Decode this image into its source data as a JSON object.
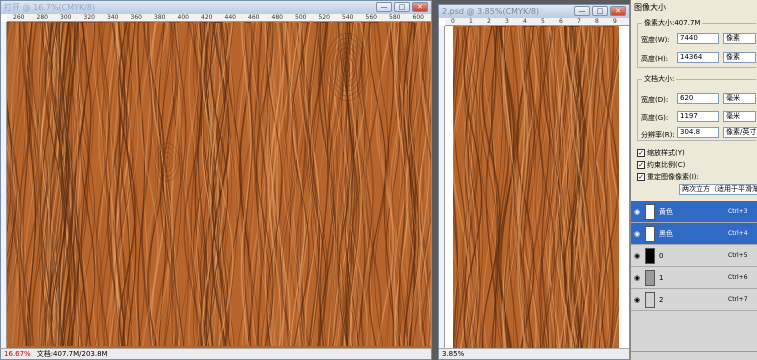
{
  "window1": {
    "title": "打开 @ 16.7%(CMYK/8)",
    "ruler_ticks": [
      "260",
      "280",
      "300",
      "320",
      "340",
      "360",
      "380",
      "400",
      "420",
      "440",
      "460",
      "480",
      "500",
      "520",
      "540",
      "560",
      "580",
      "600"
    ],
    "status_zoom": "16.67%",
    "status_doc": "文档:407.7M/203.8M"
  },
  "window2": {
    "title": "2.psd @ 3.85%(CMYK/8)",
    "ruler_ticks": [
      "0",
      "1",
      "2",
      "3",
      "4",
      "5",
      "6",
      "7",
      "8",
      "9"
    ],
    "status_zoom": "3.85%"
  },
  "window_buttons": {
    "min": "—",
    "max": "□",
    "close": "✕"
  },
  "panel": {
    "title": "图像大小",
    "pixel_group": {
      "legend": "像素大小:407.7M",
      "width_label": "宽度(W):",
      "width_value": "7440",
      "width_unit": "像素",
      "height_label": "高度(H):",
      "height_value": "14364",
      "height_unit": "像素"
    },
    "doc_group": {
      "legend": "文档大小:",
      "width_label": "宽度(D):",
      "width_value": "620",
      "width_unit": "毫米",
      "height_label": "高度(G):",
      "height_value": "1197",
      "height_unit": "毫米",
      "res_label": "分辨率(R):",
      "res_value": "304.8",
      "res_unit": "像素/英寸"
    },
    "checkboxes": [
      {
        "label": "缩放样式(Y)",
        "checked": "✓"
      },
      {
        "label": "约束比例(C)",
        "checked": "✓"
      },
      {
        "label": "重定图像像素(I):",
        "checked": "✓"
      }
    ],
    "resample": "两次立方（适用于平滑渐变）"
  },
  "layers": [
    {
      "name": "黄色",
      "shortcut": "Ctrl+3",
      "thumb": "#ffffff",
      "selected": true
    },
    {
      "name": "黑色",
      "shortcut": "Ctrl+4",
      "thumb": "#ffffff",
      "selected": true
    },
    {
      "name": "0",
      "shortcut": "Ctrl+5",
      "thumb": "#000000",
      "selected": false
    },
    {
      "name": "1",
      "shortcut": "Ctrl+6",
      "thumb": "#9a9a9a",
      "selected": false
    },
    {
      "name": "2",
      "shortcut": "Ctrl+7",
      "thumb": "#d0d0d0",
      "selected": false
    }
  ],
  "eye_icon": "eye-icon",
  "colors": {
    "wood_base": "#b8652b",
    "wood_dark": "#5a2a0e",
    "wood_light": "#e2a066",
    "selection": "#316ac5"
  }
}
